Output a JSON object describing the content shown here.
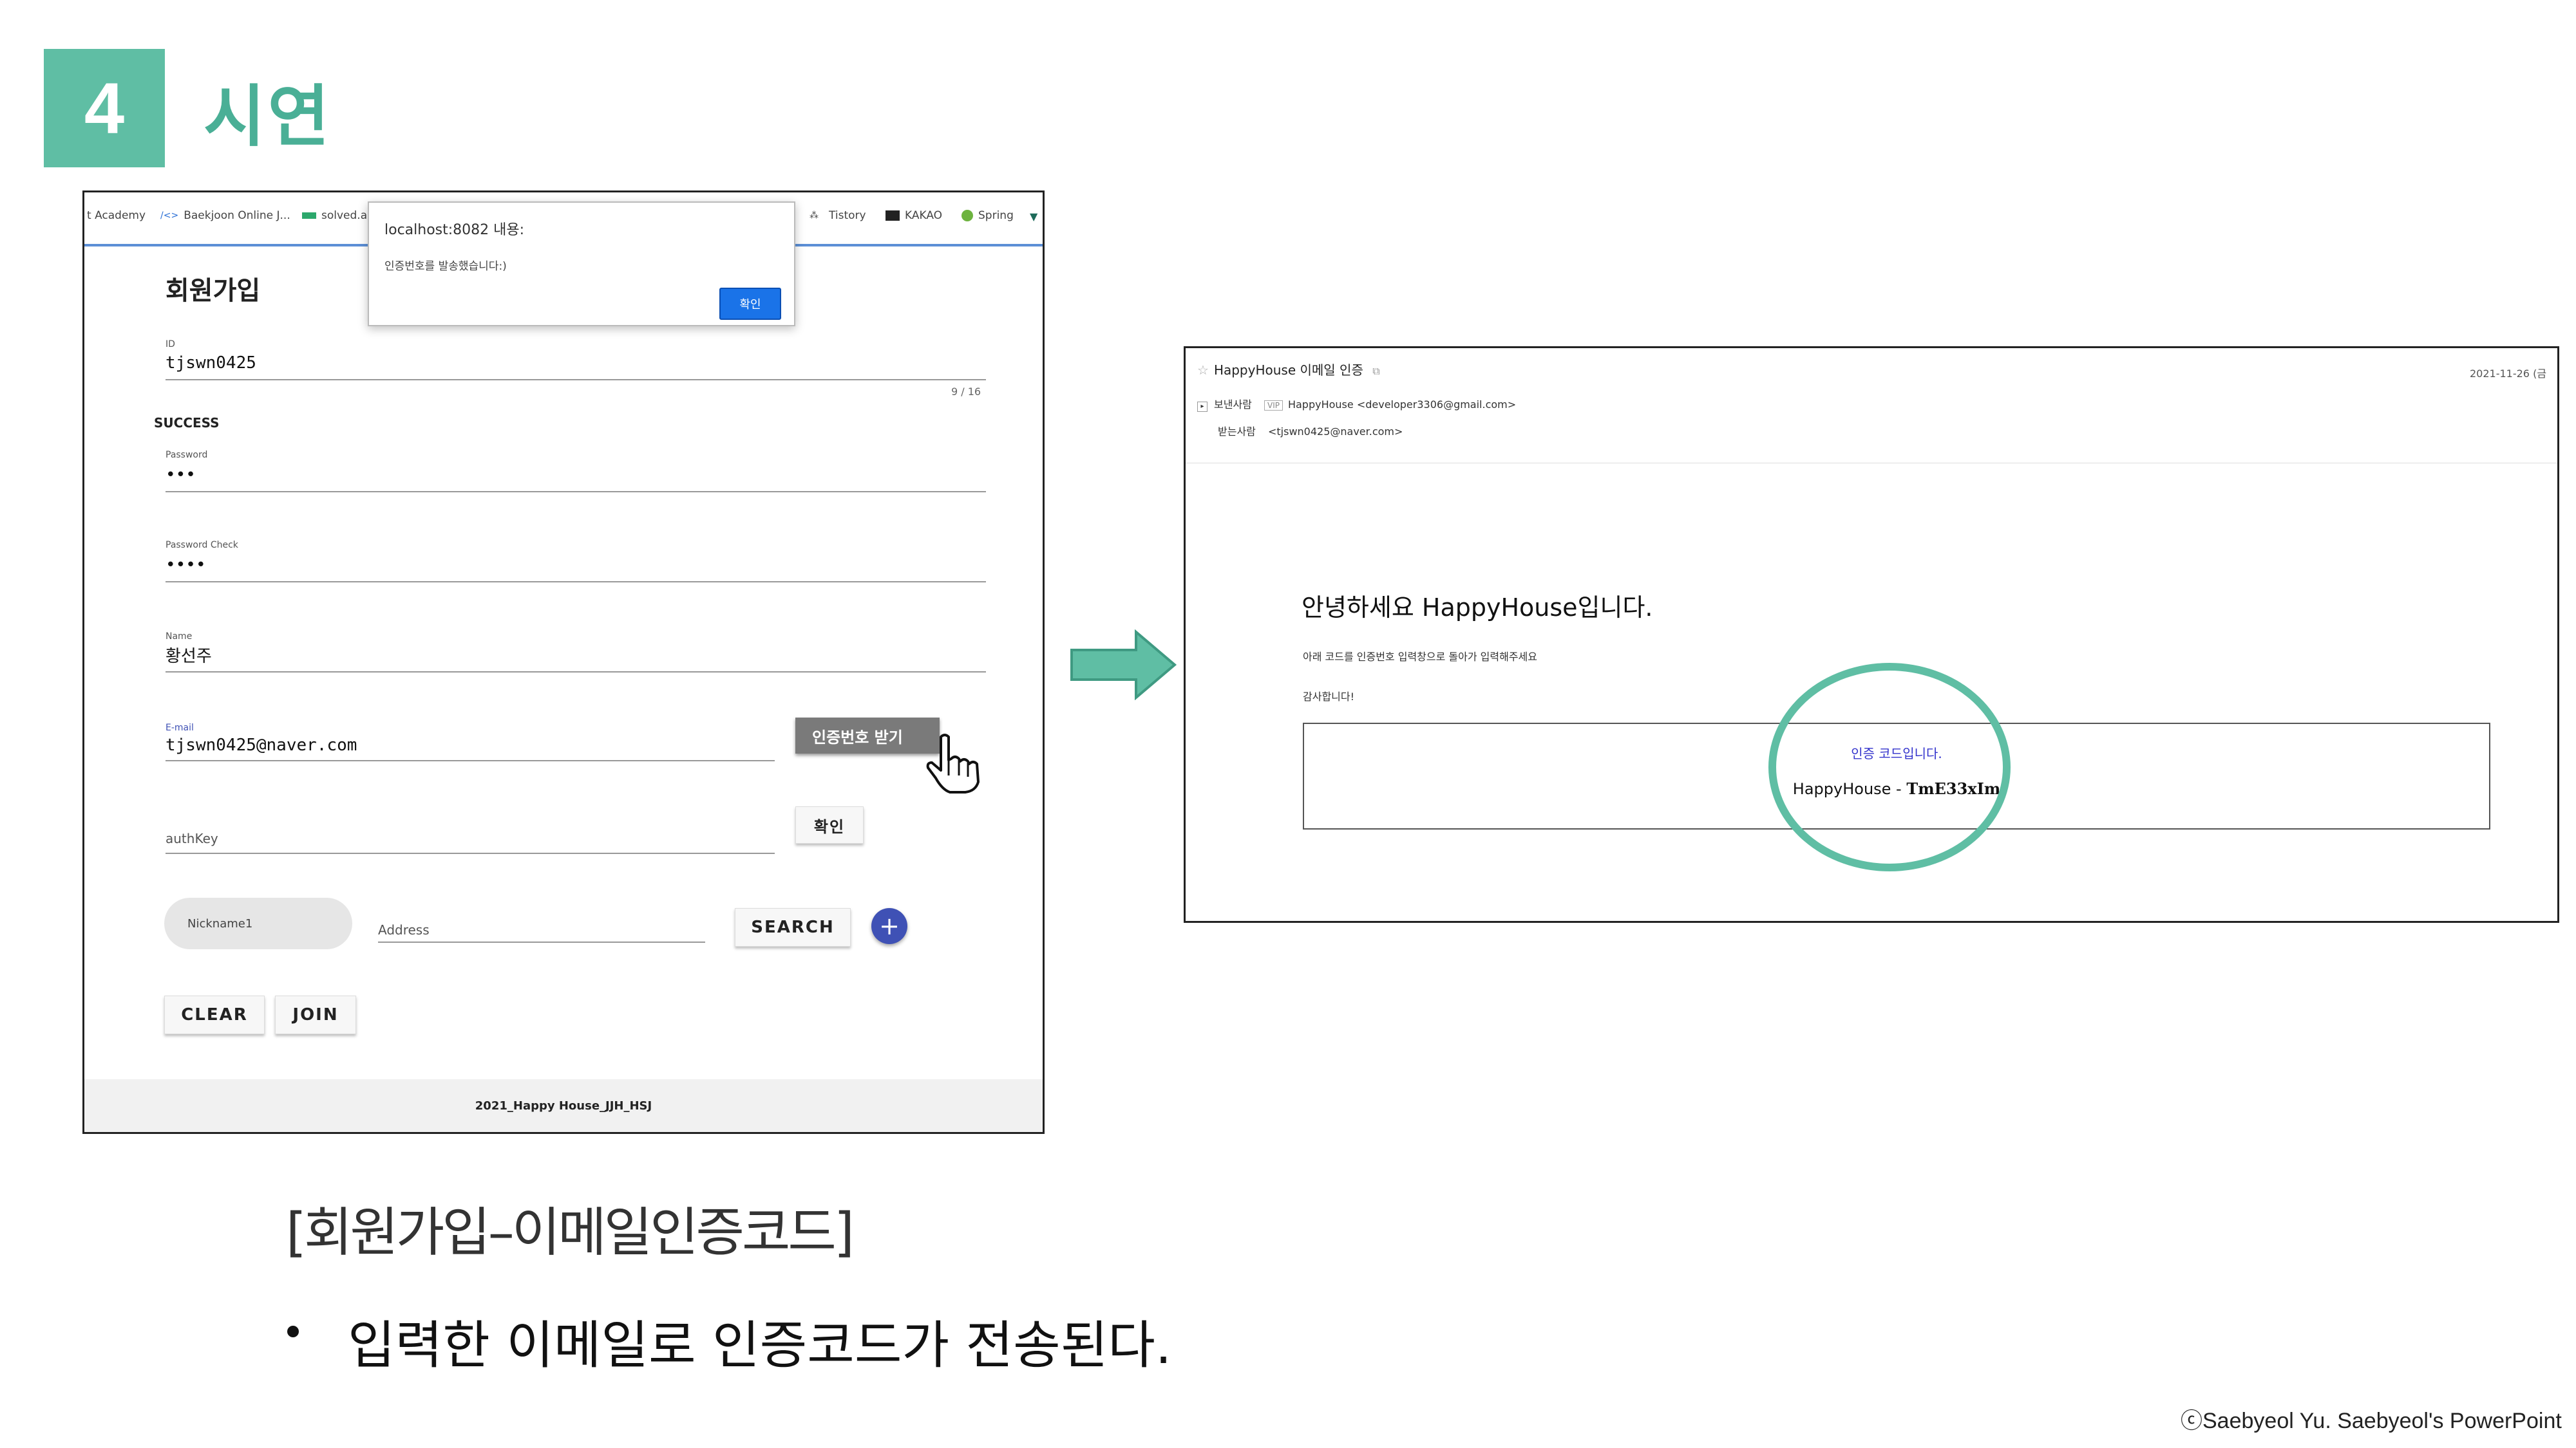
{
  "header": {
    "number": "4",
    "title": "시연"
  },
  "left_screenshot": {
    "bookmarks": [
      {
        "icon": "",
        "label": "t Academy"
      },
      {
        "icon": "/<>",
        "label": "Baekjoon Online J..."
      },
      {
        "icon": "",
        "label": "solved.a"
      },
      {
        "icon": "",
        "label": "Tistory"
      },
      {
        "icon": "",
        "label": "KAKAO"
      },
      {
        "icon": "",
        "label": "Spring"
      }
    ],
    "alert": {
      "title": "localhost:8082 내용:",
      "message": "인증번호를 발송했습니다:)",
      "ok": "확인"
    },
    "form": {
      "title": "회원가입",
      "id_label": "ID",
      "id_value": "tjswn0425",
      "counter": "9 / 16",
      "success": "SUCCESS",
      "password_label": "Password",
      "password_value": "•••",
      "password_check_label": "Password Check",
      "password_check_value": "••••",
      "name_label": "Name",
      "name_value": "황선주",
      "email_label": "E-mail",
      "email_value": "tjswn0425@naver.com",
      "send_code_button": "인증번호 받기",
      "authkey_placeholder": "authKey",
      "confirm_button": "확인",
      "nickname_placeholder": "Nickname1",
      "address_placeholder": "Address",
      "search_button": "SEARCH",
      "add_button": "+",
      "clear_button": "CLEAR",
      "join_button": "JOIN"
    },
    "footer": "2021_Happy House_JJH_HSJ"
  },
  "right_screenshot": {
    "subject": "HappyHouse 이메일 인증",
    "date": "2021-11-26 (금",
    "sender_label": "보낸사람",
    "sender_badge": "VIP",
    "sender_value": "HappyHouse <developer3306@gmail.com>",
    "receiver_label": "받는사람",
    "receiver_value": "<tjswn0425@naver.com>",
    "greeting": "안녕하세요 HappyHouse입니다.",
    "line1": "아래 코드를 인증번호 입력창으로 돌아가 입력해주세요",
    "line2": "감사합니다!",
    "code_title": "인증 코드입니다.",
    "code_prefix": "HappyHouse - ",
    "code": "TmE33xIm"
  },
  "caption": "[회원가입–이메일인증코드]",
  "bullet": "입력한 이메일로 인증코드가 전송된다.",
  "copyright": "ⓒSaebyeol Yu. Saebyeol's PowerPoint",
  "colors": {
    "accent": "#5fbea4",
    "title": "#4aaf96",
    "fab": "#3f51b5",
    "alert_button": "#1a73e8"
  }
}
